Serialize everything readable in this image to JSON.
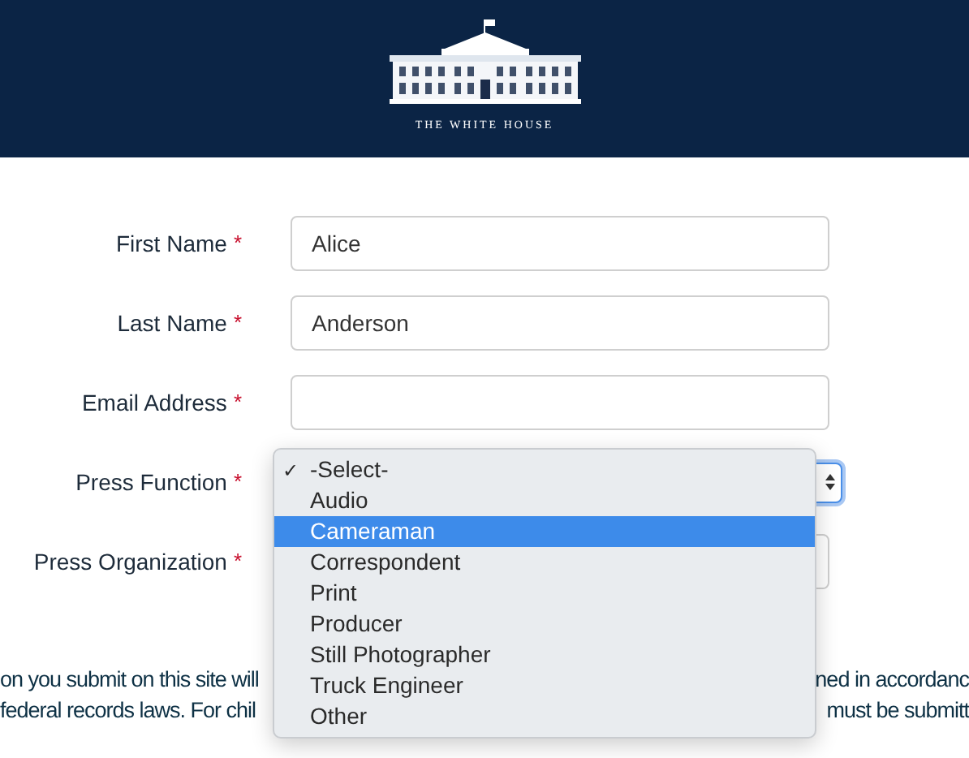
{
  "header": {
    "logo_text": "THE WHITE HOUSE"
  },
  "form": {
    "fields": [
      {
        "label": "First Name",
        "required_mark": "*",
        "kind": "text",
        "value": "Alice"
      },
      {
        "label": "Last Name",
        "required_mark": "*",
        "kind": "text",
        "value": "Anderson"
      },
      {
        "label": "Email Address",
        "required_mark": "*",
        "kind": "text"
      },
      {
        "label": "Press Function",
        "required_mark": "*",
        "kind": "select",
        "expanded": true
      },
      {
        "label": "Press Organization",
        "required_mark": "*",
        "kind": "text"
      }
    ]
  },
  "dropdown": {
    "check_mark": "✓",
    "options": [
      {
        "label": "-Select-",
        "selected": true,
        "highlighted": false
      },
      {
        "label": "Audio",
        "selected": false,
        "highlighted": false
      },
      {
        "label": "Cameraman",
        "selected": false,
        "highlighted": true
      },
      {
        "label": "Correspondent",
        "selected": false,
        "highlighted": false
      },
      {
        "label": "Print",
        "selected": false,
        "highlighted": false
      },
      {
        "label": "Producer",
        "selected": false,
        "highlighted": false
      },
      {
        "label": "Still Photographer",
        "selected": false,
        "highlighted": false
      },
      {
        "label": "Truck Engineer",
        "selected": false,
        "highlighted": false
      },
      {
        "label": "Other",
        "selected": false,
        "highlighted": false
      }
    ]
  },
  "notice": {
    "lines": [
      {
        "left": "on you submit on this site will",
        "right": "ned in accordanc"
      },
      {
        "left": "federal records laws. For chil",
        "right": "must be submitt"
      }
    ]
  }
}
